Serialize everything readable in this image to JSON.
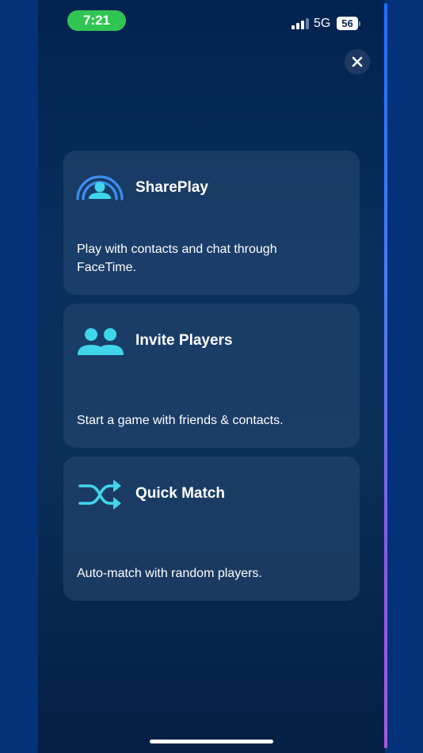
{
  "status_bar": {
    "time": "7:21",
    "network": "5G",
    "battery": "56"
  },
  "close": {
    "icon": "close-icon"
  },
  "options": [
    {
      "title": "SharePlay",
      "description": "Play with contacts and chat through FaceTime.",
      "icon": "shareplay-icon"
    },
    {
      "title": "Invite Players",
      "description": "Start a game with friends & contacts.",
      "icon": "people-icon"
    },
    {
      "title": "Quick Match",
      "description": "Auto-match with random players.",
      "icon": "shuffle-icon"
    }
  ],
  "colors": {
    "accent_blue": "#3d8ff0",
    "accent_cyan": "#3fd6ec",
    "time_pill": "#30c553"
  }
}
